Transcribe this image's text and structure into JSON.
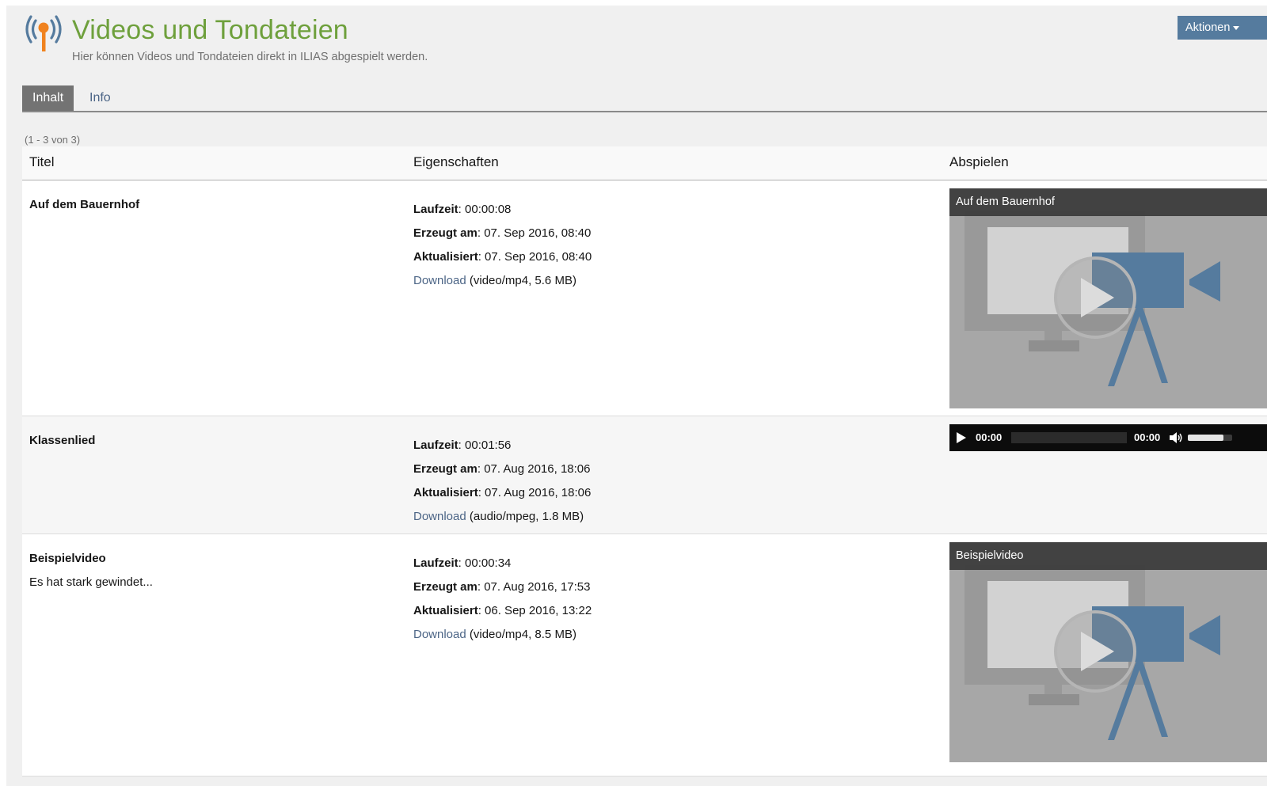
{
  "header": {
    "icon": "broadcast-icon",
    "title": "Videos und Tondateien",
    "subtitle": "Hier können Videos und Tondateien direkt in ILIAS abgespielt werden.",
    "actions_label": "Aktionen"
  },
  "tabs": [
    {
      "label": "Inhalt",
      "active": true
    },
    {
      "label": "Info",
      "active": false
    }
  ],
  "list": {
    "count_text": "(1 - 3 von 3)",
    "columns": [
      "Titel",
      "Eigenschaften",
      "Abspielen"
    ],
    "prop_labels": {
      "runtime": "Laufzeit",
      "created": "Erzeugt am",
      "updated": "Aktualisiert",
      "download": "Download"
    },
    "items": [
      {
        "title": "Auf dem Bauernhof",
        "description": "",
        "runtime": ": 00:00:08",
        "created": ": 07. Sep 2016, 08:40",
        "updated": ": 07. Sep 2016, 08:40",
        "file_info": " (video/mp4, 5.6 MB)",
        "player": {
          "type": "video",
          "caption": "Auf dem Bauernhof"
        }
      },
      {
        "title": "Klassenlied",
        "description": "",
        "runtime": ": 00:01:56",
        "created": ": 07. Aug 2016, 18:06",
        "updated": ": 07. Aug 2016, 18:06",
        "file_info": " (audio/mpeg, 1.8 MB)",
        "player": {
          "type": "audio",
          "current_time": "00:00",
          "duration": "00:00",
          "volume": 0.8
        }
      },
      {
        "title": "Beispielvideo",
        "description": "Es hat stark gewindet...",
        "runtime": ": 00:00:34",
        "created": ": 07. Aug 2016, 17:53",
        "updated": ": 06. Sep 2016, 13:22",
        "file_info": " (video/mp4, 8.5 MB)",
        "player": {
          "type": "video",
          "caption": "Beispielvideo"
        }
      }
    ]
  },
  "colors": {
    "title_green": "#6ea03c",
    "link_blue": "#4c6586",
    "action_button": "#557b9e",
    "tab_active": "#737373",
    "icon_orange": "#f0821e",
    "icon_blue": "#557b9e"
  }
}
